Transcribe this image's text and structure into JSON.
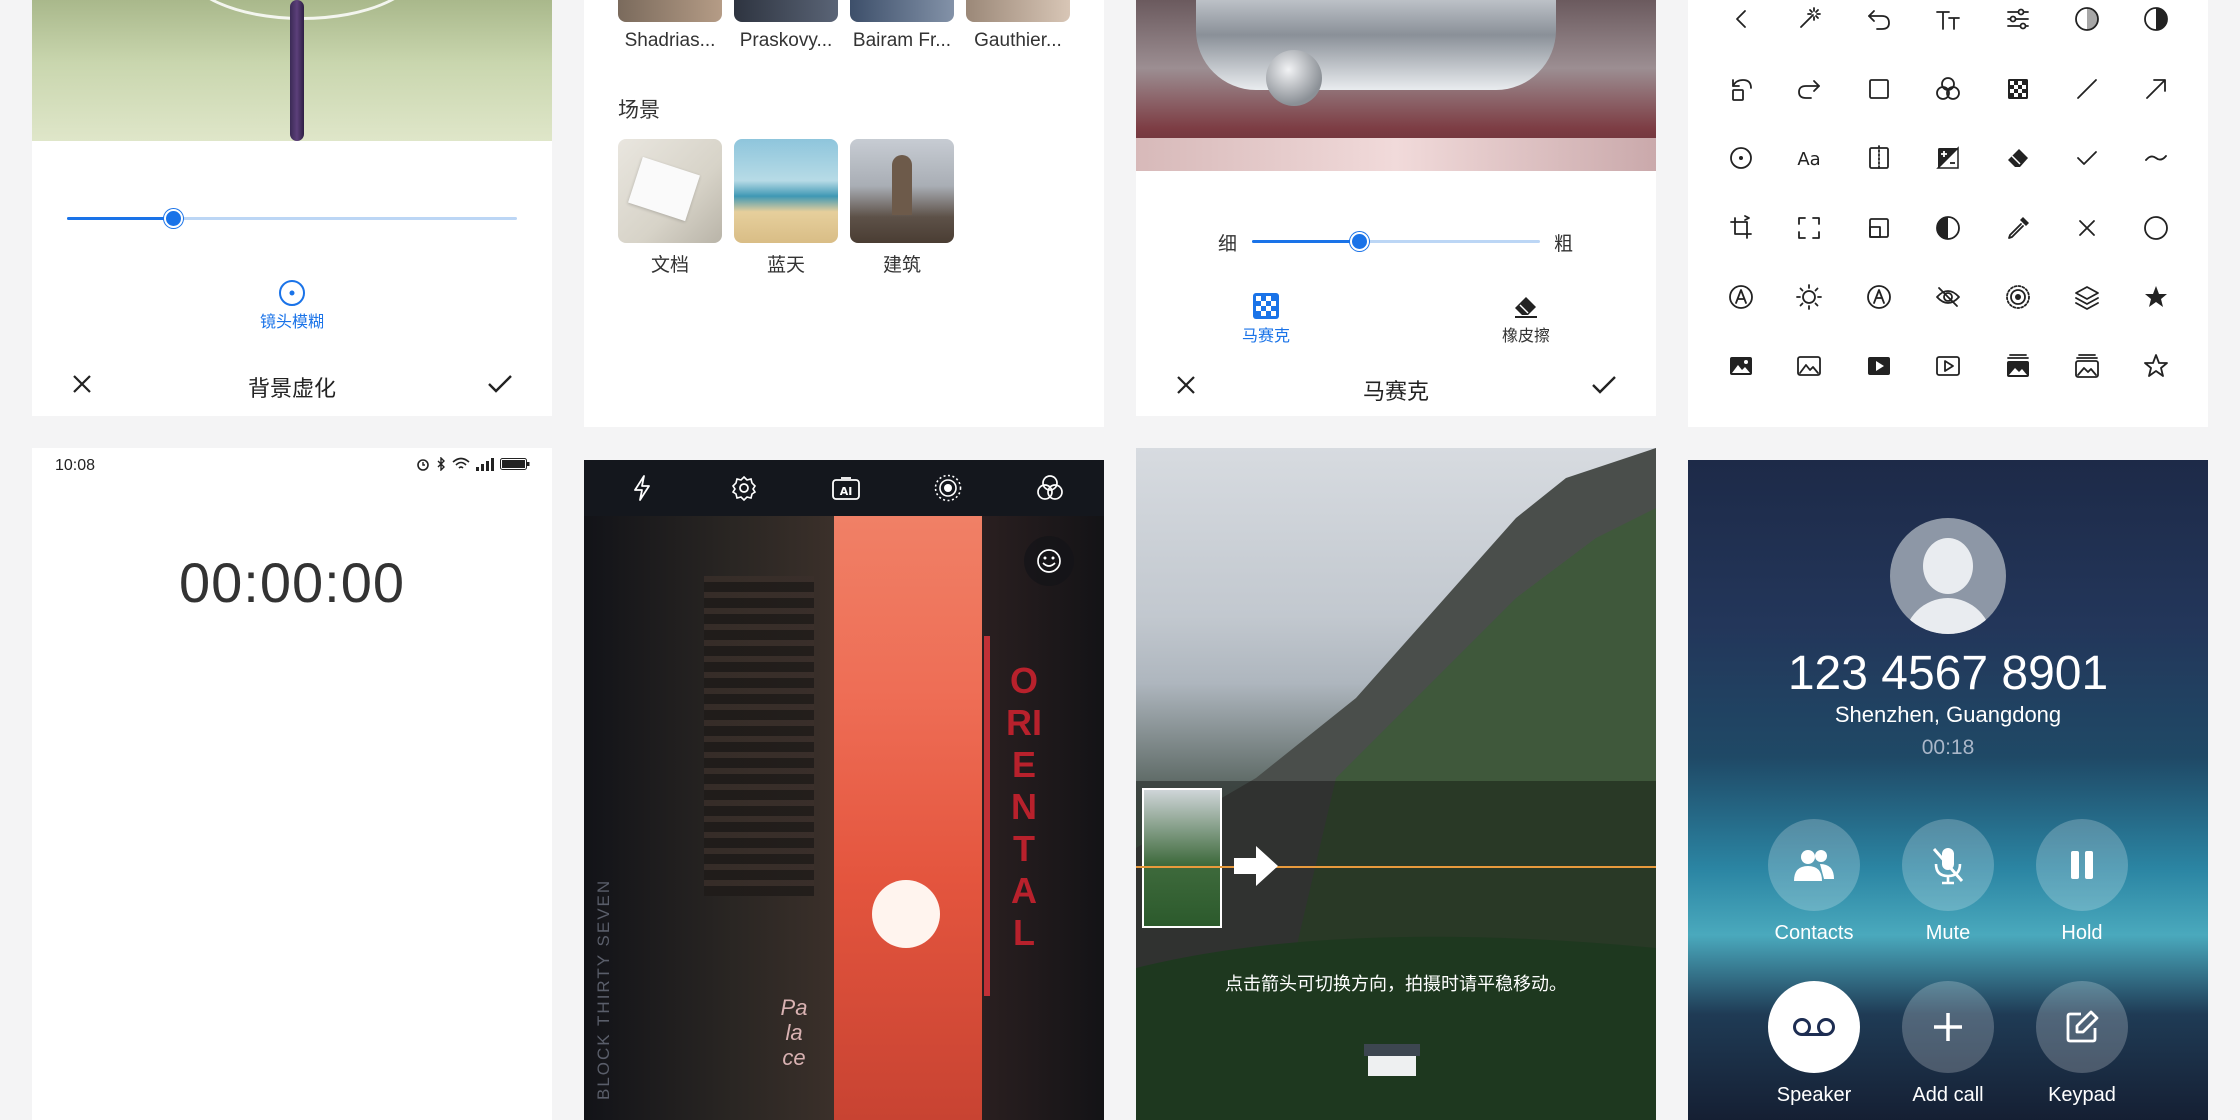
{
  "blur_panel": {
    "mode_label": "镜头模糊",
    "title": "背景虚化",
    "slider_value": 0.24
  },
  "gallery_panel": {
    "people": [
      {
        "name": "Shadrias..."
      },
      {
        "name": "Praskovy..."
      },
      {
        "name": "Bairam Fr..."
      },
      {
        "name": "Gauthier..."
      }
    ],
    "scene_heading": "场景",
    "scenes": [
      {
        "label": "文档"
      },
      {
        "label": "蓝天"
      },
      {
        "label": "建筑"
      }
    ]
  },
  "mosaic_panel": {
    "thin_label": "细",
    "thick_label": "粗",
    "slider_value": 0.37,
    "tools": [
      {
        "label": "马赛克",
        "active": true
      },
      {
        "label": "橡皮擦",
        "active": false
      }
    ],
    "title": "马赛克"
  },
  "icon_grid": {
    "rows": [
      [
        "chevron-left-icon",
        "magic-wand-icon",
        "undo-icon",
        "text-size-icon",
        "sliders-icon",
        "contrast-dots-icon",
        "half-circle-icon"
      ],
      [
        "rotate-icon",
        "redo-icon",
        "square-icon",
        "filter-icon",
        "mosaic-icon",
        "line-icon",
        "arrow-icon"
      ],
      [
        "target-icon",
        "font-icon",
        "mirror-icon",
        "exposure-icon",
        "eraser-icon",
        "check-icon",
        "curve-icon"
      ],
      [
        "crop-rotate-icon",
        "fullscreen-icon",
        "resize-icon",
        "contrast-icon",
        "eyedropper-icon",
        "close-icon",
        "circle-icon"
      ],
      [
        "pen-circle-icon",
        "brightness-icon",
        "auto-text-icon",
        "hide-icon",
        "aperture-icon",
        "layers-icon",
        "star-filled-icon"
      ],
      [
        "image-filled-icon",
        "image-icon",
        "video-filled-icon",
        "video-icon",
        "gallery-filled-icon",
        "gallery-icon",
        "star-icon"
      ]
    ]
  },
  "stopwatch": {
    "status_time": "10:08",
    "display": "00:00:00"
  },
  "camera": {
    "toolbar": [
      "flash-icon",
      "settings-icon",
      "ai-icon",
      "live-icon",
      "filter-icon"
    ],
    "sticker_icon": "smiley-icon",
    "signs": {
      "vertical_red": "ORIENTAL",
      "building": "BLOCK THIRTY SEVEN",
      "palace": "Palace"
    }
  },
  "panorama": {
    "hint": "点击箭头可切换方向，拍摄时请平稳移动。"
  },
  "call": {
    "number": "123 4567 8901",
    "location": "Shenzhen, Guangdong",
    "duration": "00:18",
    "buttons": [
      {
        "label": "Contacts",
        "icon": "contacts-icon"
      },
      {
        "label": "Mute",
        "icon": "mic-off-icon"
      },
      {
        "label": "Hold",
        "icon": "pause-icon"
      },
      {
        "label": "Speaker",
        "icon": "voicemail-icon"
      },
      {
        "label": "Add call",
        "icon": "plus-icon"
      },
      {
        "label": "Keypad",
        "icon": "edit-icon"
      }
    ]
  }
}
